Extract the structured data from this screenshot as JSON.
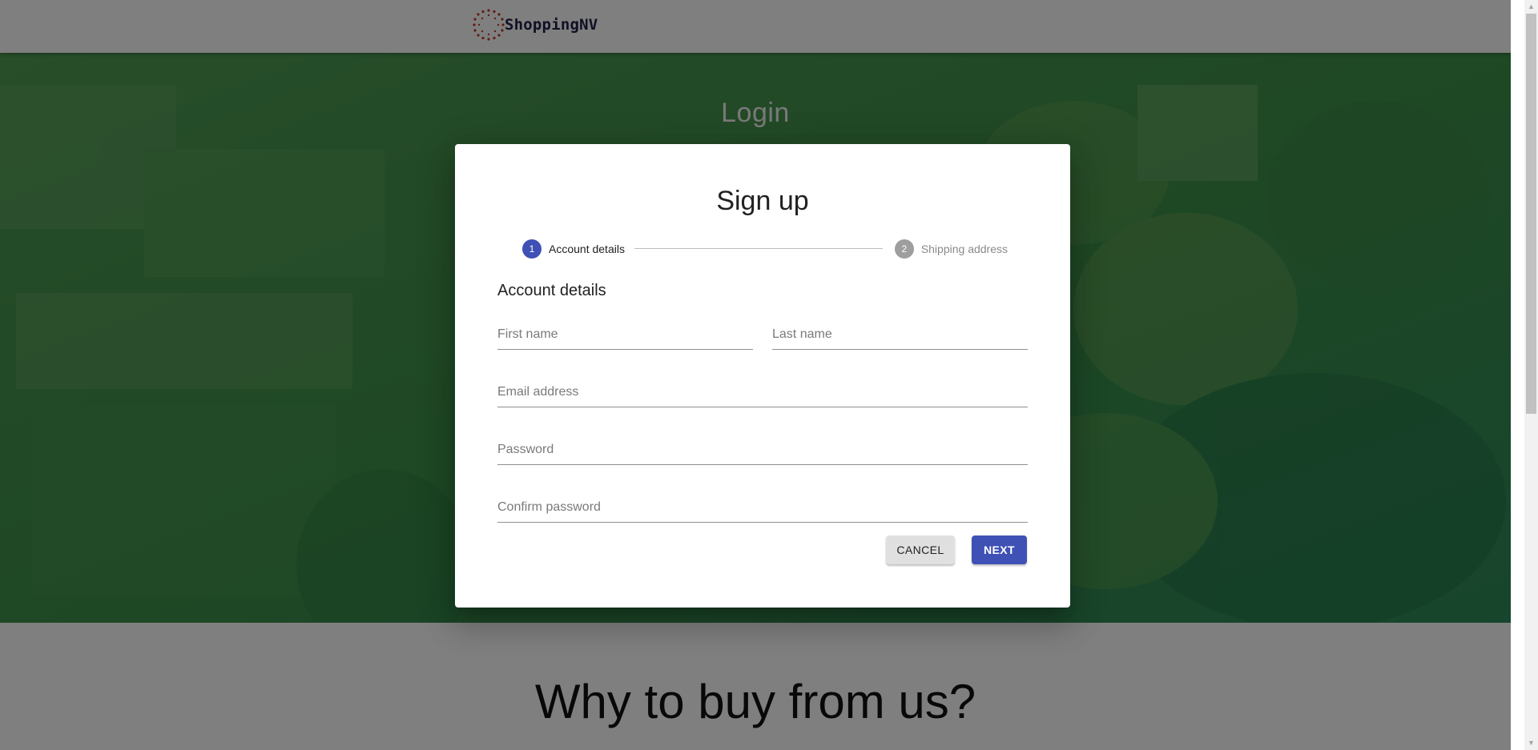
{
  "header": {
    "brand": "ShoppingNV"
  },
  "hero": {
    "title": "Login"
  },
  "section": {
    "why_title": "Why to buy from us?"
  },
  "dialog": {
    "title": "Sign up",
    "stepper": {
      "steps": [
        {
          "number": "1",
          "label": "Account details",
          "active": true
        },
        {
          "number": "2",
          "label": "Shipping address",
          "active": false
        }
      ]
    },
    "section_title": "Account details",
    "fields": {
      "first_name": {
        "placeholder": "First name",
        "value": ""
      },
      "last_name": {
        "placeholder": "Last name",
        "value": ""
      },
      "email": {
        "placeholder": "Email address",
        "value": ""
      },
      "password": {
        "placeholder": "Password",
        "value": ""
      },
      "confirm_password": {
        "placeholder": "Confirm password",
        "value": ""
      }
    },
    "buttons": {
      "cancel": "CANCEL",
      "next": "NEXT"
    }
  },
  "colors": {
    "primary": "#3f51b5",
    "inactive_step": "#9e9e9e",
    "hero_green": "#3c8f4a",
    "overlay": "rgba(0,0,0,0.5)"
  }
}
